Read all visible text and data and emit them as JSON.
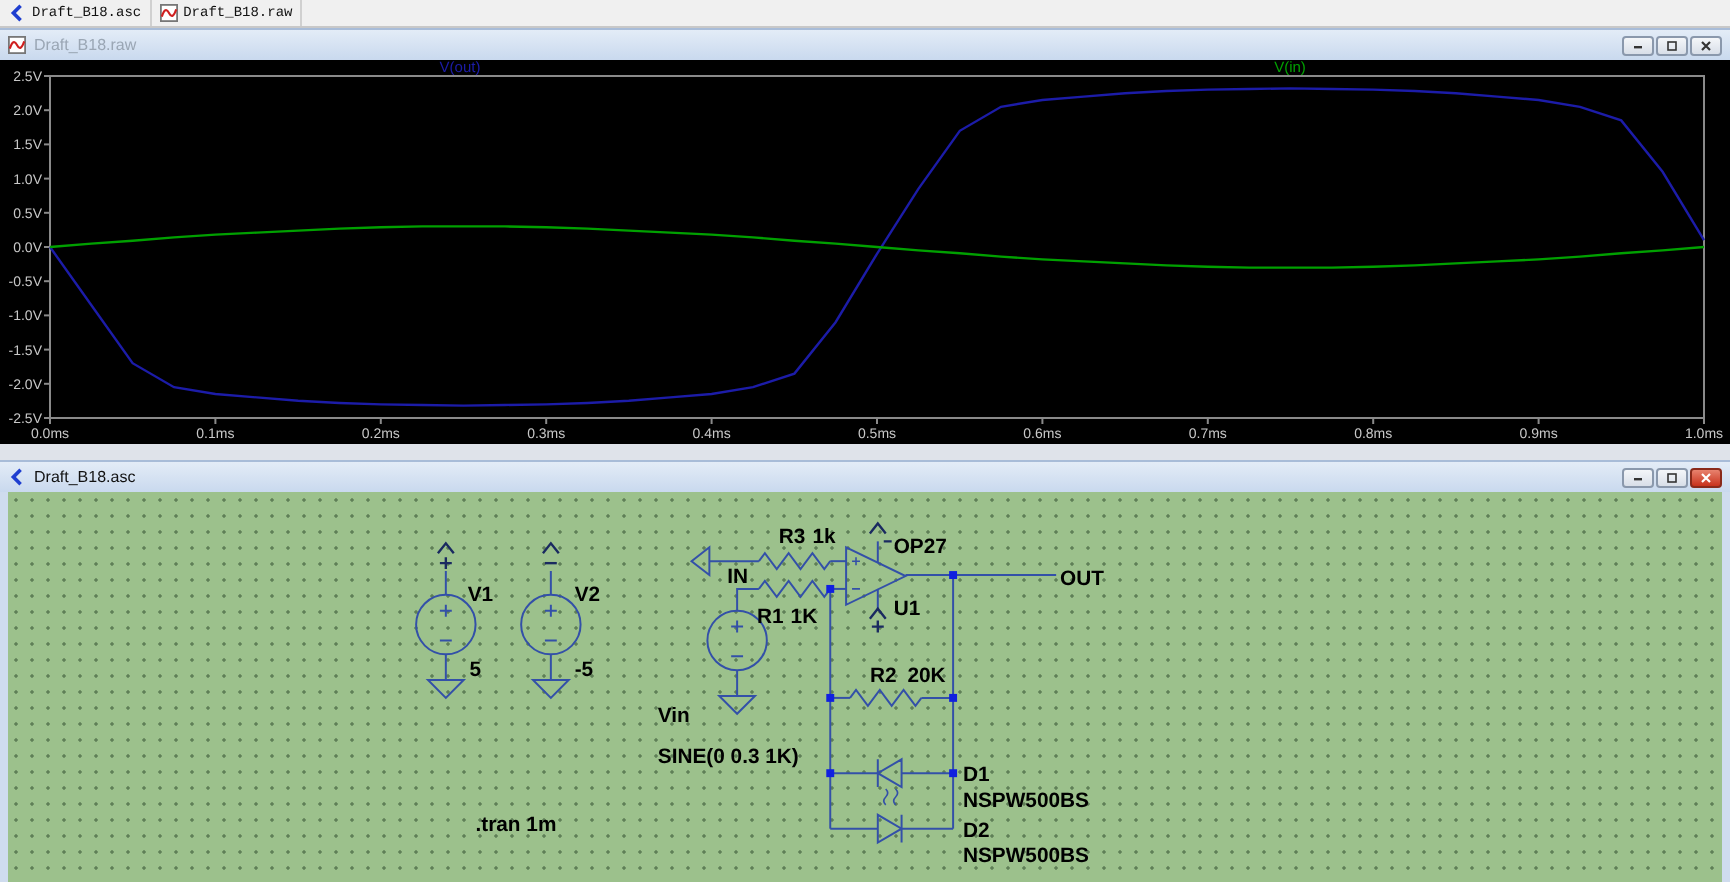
{
  "tabs": [
    {
      "label": "Draft_B18.asc",
      "kind": "schematic"
    },
    {
      "label": "Draft_B18.raw",
      "kind": "waveform"
    }
  ],
  "plot_window": {
    "title": "Draft_B18.raw",
    "kind": "waveform",
    "active": false,
    "chart_data": {
      "type": "line",
      "xlim": [
        0,
        1
      ],
      "ylim": [
        -2.5,
        2.5
      ],
      "xticks": [
        {
          "value": 0,
          "label": "0.0ms"
        },
        {
          "value": 0.1,
          "label": "0.1ms"
        },
        {
          "value": 0.2,
          "label": "0.2ms"
        },
        {
          "value": 0.3,
          "label": "0.3ms"
        },
        {
          "value": 0.4,
          "label": "0.4ms"
        },
        {
          "value": 0.5,
          "label": "0.5ms"
        },
        {
          "value": 0.6,
          "label": "0.6ms"
        },
        {
          "value": 0.7,
          "label": "0.7ms"
        },
        {
          "value": 0.8,
          "label": "0.8ms"
        },
        {
          "value": 0.9,
          "label": "0.9ms"
        },
        {
          "value": 1,
          "label": "1.0ms"
        }
      ],
      "yticks": [
        {
          "value": 2.5,
          "label": "2.5V"
        },
        {
          "value": 2,
          "label": "2.0V"
        },
        {
          "value": 1.5,
          "label": "1.5V"
        },
        {
          "value": 1,
          "label": "1.0V"
        },
        {
          "value": 0.5,
          "label": "0.5V"
        },
        {
          "value": 0,
          "label": "0.0V"
        },
        {
          "value": -0.5,
          "label": "-0.5V"
        },
        {
          "value": -1,
          "label": "-1.0V"
        },
        {
          "value": -1.5,
          "label": "-1.5V"
        },
        {
          "value": -2,
          "label": "-2.0V"
        },
        {
          "value": -2.5,
          "label": "-2.5V"
        }
      ],
      "x": [
        0,
        0.025,
        0.05,
        0.075,
        0.1,
        0.125,
        0.15,
        0.175,
        0.2,
        0.225,
        0.25,
        0.275,
        0.3,
        0.325,
        0.35,
        0.375,
        0.4,
        0.425,
        0.45,
        0.475,
        0.5,
        0.525,
        0.55,
        0.575,
        0.6,
        0.625,
        0.65,
        0.675,
        0.7,
        0.725,
        0.75,
        0.775,
        0.8,
        0.825,
        0.85,
        0.875,
        0.9,
        0.925,
        0.95,
        0.975,
        1
      ],
      "series": [
        {
          "name": "V(out)",
          "color": "#1c1ca8",
          "values": [
            0,
            -0.85,
            -1.7,
            -2.05,
            -2.15,
            -2.2,
            -2.25,
            -2.28,
            -2.3,
            -2.31,
            -2.32,
            -2.31,
            -2.3,
            -2.28,
            -2.25,
            -2.2,
            -2.15,
            -2.05,
            -1.85,
            -1.1,
            -0.1,
            0.85,
            1.7,
            2.05,
            2.15,
            2.2,
            2.25,
            2.28,
            2.3,
            2.31,
            2.32,
            2.31,
            2.3,
            2.28,
            2.25,
            2.2,
            2.15,
            2.05,
            1.85,
            1.1,
            0.1
          ]
        },
        {
          "name": "V(in)",
          "color": "#00a000",
          "values": [
            0,
            0.05,
            0.09,
            0.14,
            0.18,
            0.21,
            0.24,
            0.27,
            0.29,
            0.3,
            0.3,
            0.3,
            0.29,
            0.27,
            0.24,
            0.21,
            0.18,
            0.14,
            0.09,
            0.05,
            0,
            -0.05,
            -0.09,
            -0.14,
            -0.18,
            -0.21,
            -0.24,
            -0.27,
            -0.29,
            -0.3,
            -0.3,
            -0.3,
            -0.29,
            -0.27,
            -0.24,
            -0.21,
            -0.18,
            -0.14,
            -0.09,
            -0.05,
            0
          ]
        }
      ]
    }
  },
  "schematic_window": {
    "title": "Draft_B18.asc",
    "kind": "schematic",
    "active": true,
    "sources": [
      {
        "kind": "supply",
        "ref": "V1",
        "value": "5"
      },
      {
        "kind": "supply",
        "ref": "V2",
        "value": "-5"
      },
      {
        "kind": "signal",
        "ref": "Vin",
        "value": "SINE(0 0.3 1K)"
      }
    ],
    "resistors": [
      {
        "ref": "R3",
        "value": "1k"
      },
      {
        "ref": "R1",
        "value": "1K"
      },
      {
        "ref": "R2",
        "value": "20K"
      }
    ],
    "opamp": {
      "model": "OP27",
      "ref": "U1"
    },
    "diodes": [
      {
        "ref": "D1",
        "model": "NSPW500BS"
      },
      {
        "ref": "D2",
        "model": "NSPW500BS"
      }
    ],
    "net_labels": [
      "IN",
      "OUT"
    ],
    "directive": ".tran 1m"
  }
}
